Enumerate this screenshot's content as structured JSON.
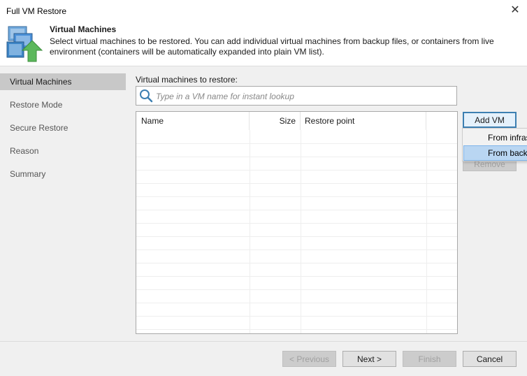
{
  "window": {
    "title": "Full VM Restore",
    "close_glyph": "✕"
  },
  "header": {
    "title": "Virtual Machines",
    "description": "Select virtual machines to be restored. You can add individual virtual machines from backup files, or containers from live environment (containers will be automatically expanded into plain VM list)."
  },
  "nav": {
    "items": [
      {
        "label": "Virtual Machines",
        "active": true
      },
      {
        "label": "Restore Mode",
        "active": false
      },
      {
        "label": "Secure Restore",
        "active": false
      },
      {
        "label": "Reason",
        "active": false
      },
      {
        "label": "Summary",
        "active": false
      }
    ]
  },
  "main": {
    "section_label": "Virtual machines to restore:",
    "search": {
      "placeholder": "Type in a VM name for instant lookup",
      "value": "",
      "icon": "search-icon"
    },
    "table": {
      "columns": [
        "Name",
        "Size",
        "Restore point",
        ""
      ],
      "rows": []
    },
    "side_buttons": {
      "add_vm": "Add VM",
      "remove": "Remove"
    },
    "add_vm_menu": {
      "items": [
        {
          "label": "From infrastructure",
          "visible_text": "From infras",
          "highlighted": false
        },
        {
          "label": "From backup",
          "visible_text": "From back",
          "highlighted": true
        }
      ]
    }
  },
  "footer": {
    "previous": "< Previous",
    "next": "Next >",
    "finish": "Finish",
    "cancel": "Cancel"
  },
  "colors": {
    "accent_border": "#3c7fb1",
    "menu_highlight": "#b9d6f2",
    "nav_active": "#c8c8c8",
    "logo_arrow": "#5cb85c",
    "logo_blue": "#4a90d9"
  }
}
